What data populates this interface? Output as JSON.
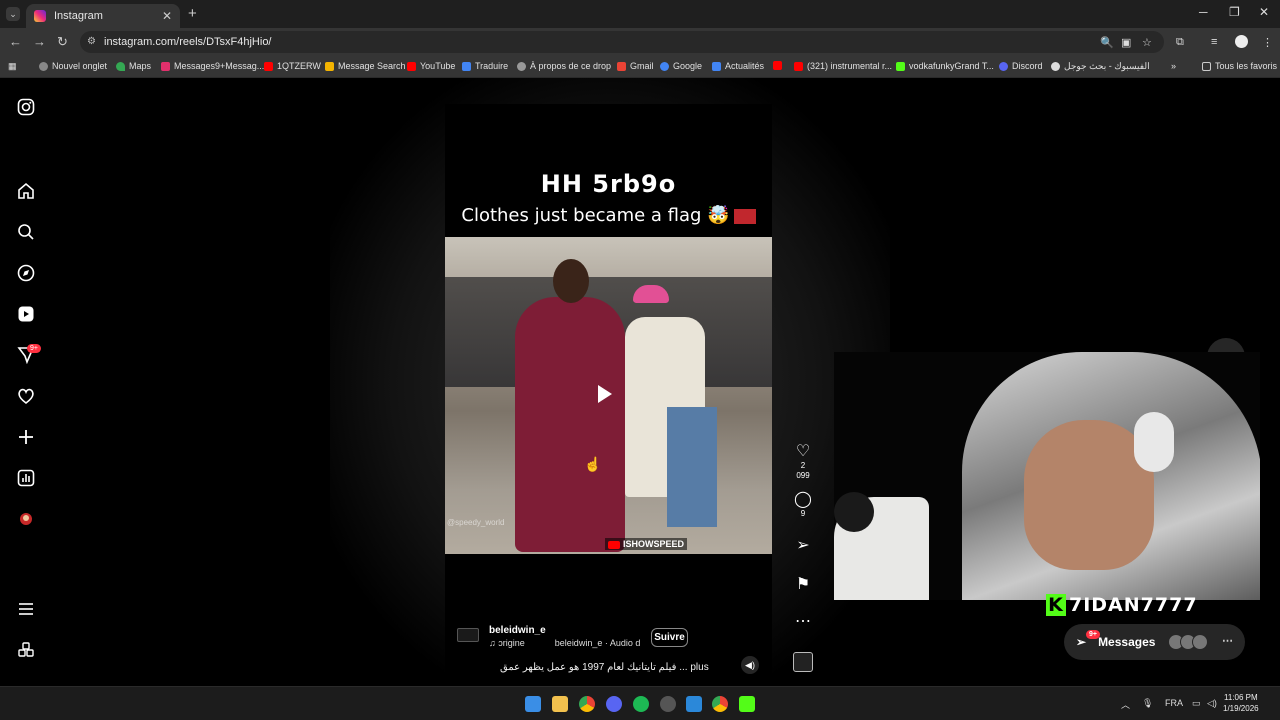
{
  "browser": {
    "tab_title": "Instagram",
    "url": "instagram.com/reels/DTsxF4hjHio/",
    "bookmarks": [
      "Nouvel onglet",
      "Maps",
      "Messages9+Messag...",
      "1QTZERW",
      "Message Search",
      "YouTube",
      "Traduire",
      "À propos de ce drop",
      "Gmail",
      "Google",
      "Actualités",
      "",
      "(321) instrumental r...",
      "vodkafunkyGrand T...",
      "Discord",
      "الفيسبوك - بحث جوجل"
    ],
    "all_bookmarks": "Tous les favoris"
  },
  "sidebar": {
    "icons": [
      "instagram-logo-icon",
      "home-icon",
      "search-icon",
      "explore-icon",
      "reels-icon",
      "messages-icon",
      "notifications-icon",
      "create-icon",
      "dashboard-icon",
      "profile-icon",
      "menu-icon",
      "apps-icon"
    ],
    "messages_badge": "9+"
  },
  "reel": {
    "title": "HH 5rb9o",
    "subtitle": "Clothes just became a flag 🤯",
    "watermark": "@speedy_world",
    "channel_tag": "ISHOWSPEED",
    "author": "beleidwin_e",
    "audio_origin": "ɔrigine",
    "audio_label": "beleidwin_e · Audio d",
    "follow_label": "Suivre",
    "description": "فيلم تايتانيك لعام 1997 هو عمل يظهر عمق ... plus",
    "likes": "2 099",
    "comments": "9"
  },
  "overlay": {
    "streamer_name": "7IDAN7777",
    "messages_label": "Messages",
    "messages_badge": "9+"
  },
  "taskbar": {
    "lang": "FRA",
    "time": "11:06 PM",
    "date": "1/19/2026"
  }
}
